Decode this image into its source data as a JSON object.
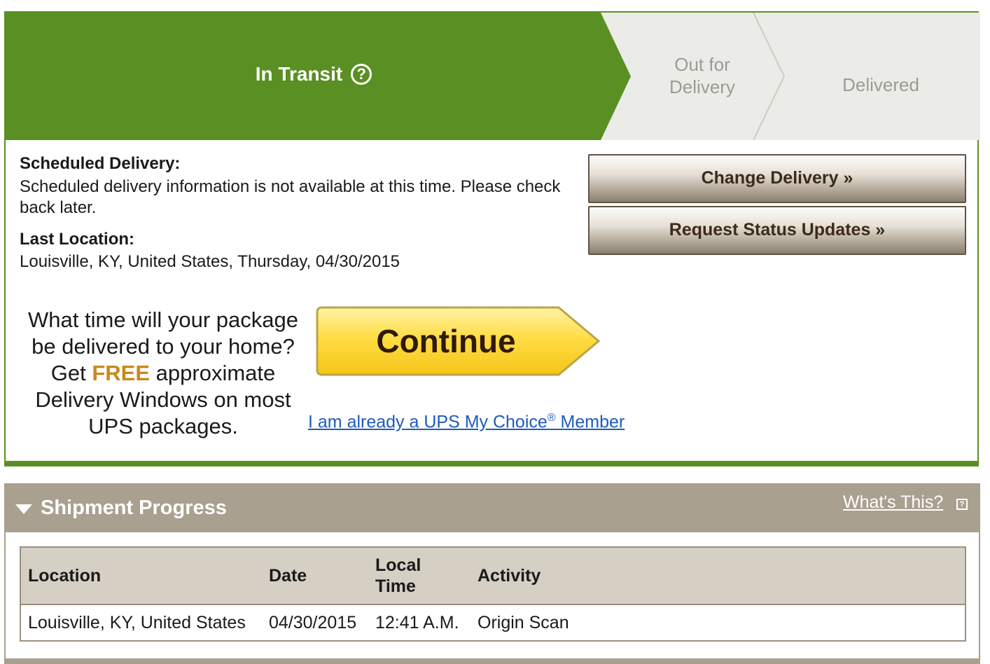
{
  "status_steps": {
    "current": "In Transit",
    "out_for_delivery": [
      "Out for",
      "Delivery"
    ],
    "delivered": "Delivered"
  },
  "icons": {
    "help": "?",
    "info": "?"
  },
  "scheduled": {
    "title": "Scheduled Delivery:",
    "text": "Scheduled delivery information is not available at this time. Please check back later."
  },
  "last_location": {
    "title": "Last Location:",
    "text": "Louisville, KY, United States, Thursday, 04/30/2015"
  },
  "actions": {
    "change_delivery": "Change Delivery »",
    "request_updates": "Request Status Updates »"
  },
  "promo": {
    "line1": "What time will your package be delivered to your home?",
    "get": "Get",
    "free": "FREE",
    "rest": "approximate Delivery Windows on most UPS packages.",
    "continue": "Continue",
    "member_link_pre": "I am already a UPS My Choice",
    "member_link_reg": "®",
    "member_link_post": " Member"
  },
  "shipment_progress": {
    "title": "Shipment Progress",
    "whats_this": "What's This?",
    "columns": [
      "Location",
      "Date",
      "Local Time",
      "Activity"
    ],
    "rows": [
      [
        "Louisville, KY, United States",
        "04/30/2015",
        "12:41 A.M.",
        "Origin Scan"
      ]
    ]
  },
  "colors": {
    "active_green": "#5a8f23",
    "inactive_step": "#ebebe8",
    "header_taupe": "#aaa090",
    "free_orange": "#c78a1e",
    "link_blue": "#1f5bb8"
  }
}
